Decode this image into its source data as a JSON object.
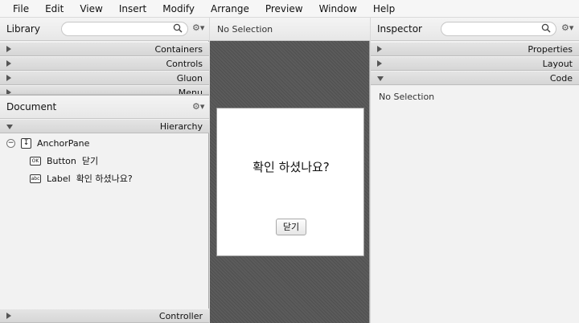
{
  "menubar": {
    "items": [
      "File",
      "Edit",
      "View",
      "Insert",
      "Modify",
      "Arrange",
      "Preview",
      "Window",
      "Help"
    ]
  },
  "library": {
    "title": "Library",
    "sections": [
      "Containers",
      "Controls",
      "Gluon",
      "Menu"
    ]
  },
  "document": {
    "title": "Document",
    "hierarchy_label": "Hierarchy",
    "controller_label": "Controller",
    "tree": {
      "root": {
        "icon": "↧",
        "label": "AnchorPane"
      },
      "children": [
        {
          "icon": "OK",
          "type": "Button",
          "text": "닫기"
        },
        {
          "icon": "abc",
          "type": "Label",
          "text": "확인 하셨나요?"
        }
      ]
    }
  },
  "content": {
    "header": "No Selection",
    "preview_label": "확인 하셨나요?",
    "preview_button": "닫기"
  },
  "inspector": {
    "title": "Inspector",
    "sections": [
      "Properties",
      "Layout",
      "Code"
    ],
    "body": "No Selection"
  }
}
